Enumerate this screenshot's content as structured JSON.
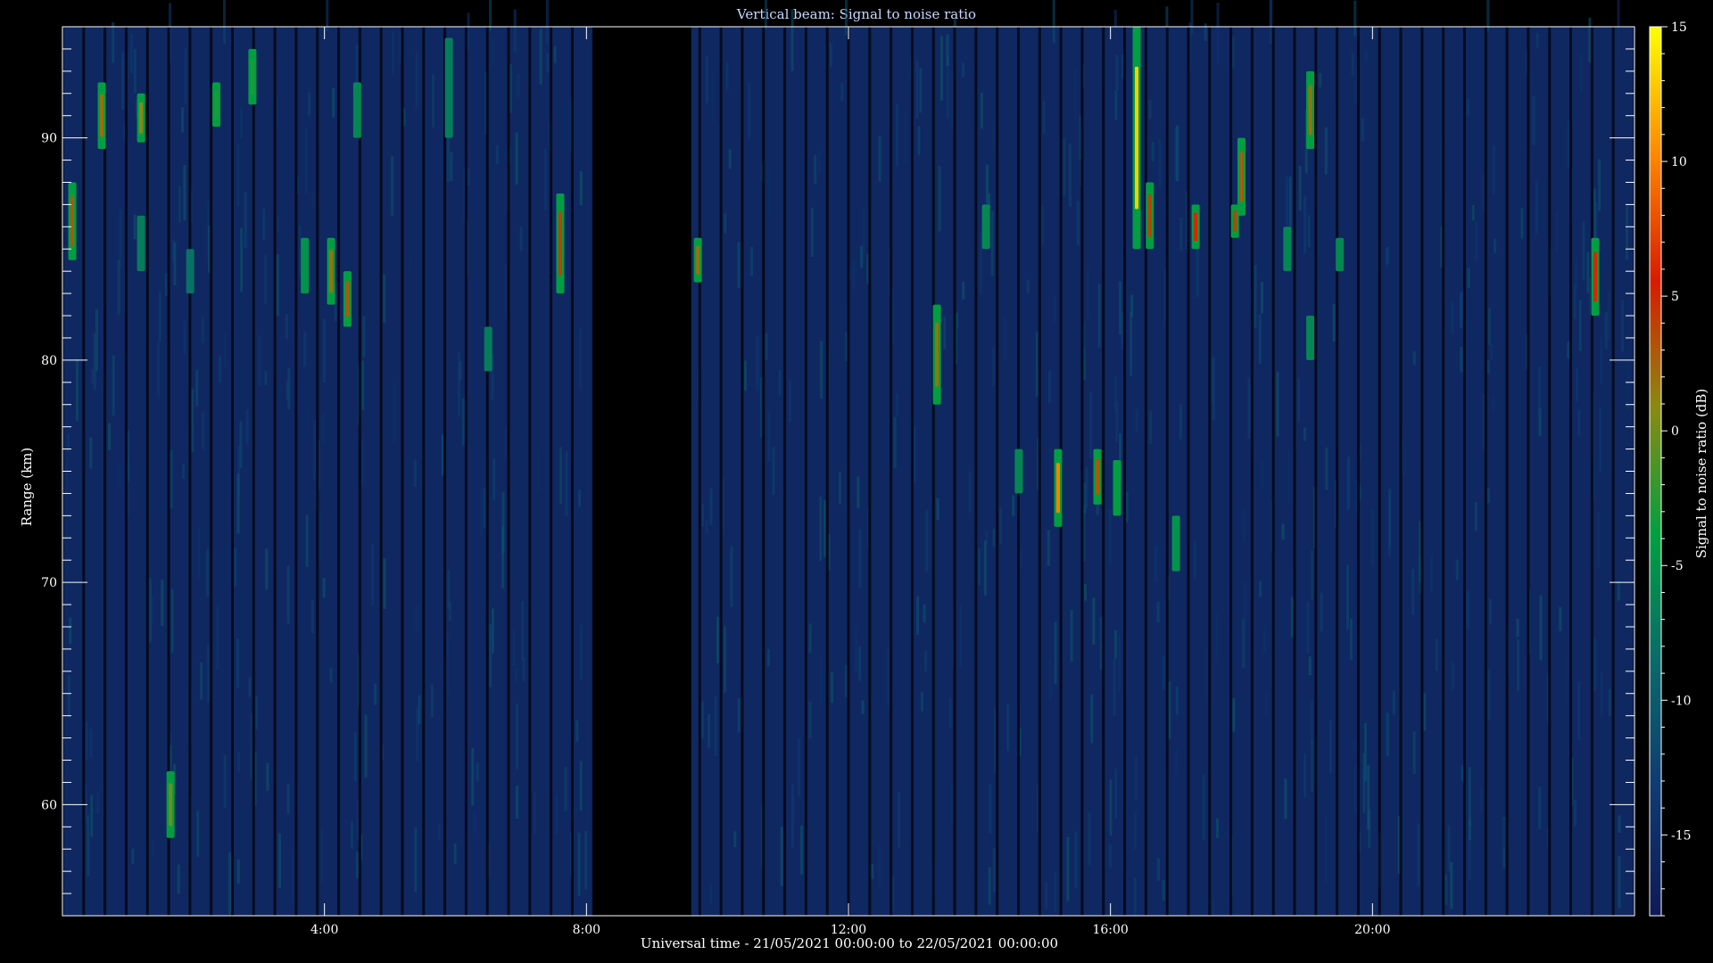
{
  "chart_data": {
    "type": "heatmap",
    "title": "Vertical beam: Signal to noise ratio",
    "xlabel": "Universal time - 21/05/2021 00:00:00 to 22/05/2021 00:00:00",
    "ylabel": "Range (km)",
    "colorbar_label": "Signal to noise ratio (dB)",
    "x_range_hours": [
      0,
      24
    ],
    "x_ticks": [
      {
        "value": 4,
        "label": "4:00"
      },
      {
        "value": 8,
        "label": "8:00"
      },
      {
        "value": 12,
        "label": "12:00"
      },
      {
        "value": 16,
        "label": "16:00"
      },
      {
        "value": 20,
        "label": "20:00"
      }
    ],
    "ylim_km": [
      55,
      95
    ],
    "y_ticks": [
      60,
      70,
      80,
      90
    ],
    "color_range_db": [
      -18,
      15
    ],
    "colorbar_ticks": [
      15,
      10,
      5,
      0,
      -5,
      -10,
      -15
    ],
    "colormap": [
      "#0f1a55",
      "#0f3a72",
      "#0a6a6a",
      "#00a040",
      "#8a8a10",
      "#d81b00",
      "#ff8800",
      "#ffff00"
    ],
    "background_db": -16,
    "data_gap_hours": [
      8.1,
      9.6
    ],
    "notable_echoes": [
      {
        "t": 0.15,
        "r_start": 84.5,
        "r_end": 88,
        "snr": 3
      },
      {
        "t": 0.6,
        "r_start": 89.5,
        "r_end": 92.5,
        "snr": 2
      },
      {
        "t": 1.2,
        "r_start": 89.8,
        "r_end": 92,
        "snr": 1
      },
      {
        "t": 1.2,
        "r_start": 84,
        "r_end": 86.5,
        "snr": -7
      },
      {
        "t": 1.65,
        "r_start": 58.5,
        "r_end": 61.5,
        "snr": 0
      },
      {
        "t": 1.95,
        "r_start": 83,
        "r_end": 85,
        "snr": -8
      },
      {
        "t": 2.35,
        "r_start": 90.5,
        "r_end": 92.5,
        "snr": -3
      },
      {
        "t": 2.9,
        "r_start": 91.5,
        "r_end": 94,
        "snr": -3
      },
      {
        "t": 3.7,
        "r_start": 83,
        "r_end": 85.5,
        "snr": -5
      },
      {
        "t": 4.1,
        "r_start": 82.5,
        "r_end": 85.5,
        "snr": 2
      },
      {
        "t": 4.35,
        "r_start": 81.5,
        "r_end": 84,
        "snr": 3
      },
      {
        "t": 4.5,
        "r_start": 90,
        "r_end": 92.5,
        "snr": -6
      },
      {
        "t": 5.9,
        "r_start": 90,
        "r_end": 94.5,
        "snr": -7
      },
      {
        "t": 6.5,
        "r_start": 79.5,
        "r_end": 81.5,
        "snr": -7
      },
      {
        "t": 7.6,
        "r_start": 83,
        "r_end": 87.5,
        "snr": 4
      },
      {
        "t": 9.7,
        "r_start": 83.5,
        "r_end": 85.5,
        "snr": 2
      },
      {
        "t": 13.35,
        "r_start": 78,
        "r_end": 82.5,
        "snr": 2
      },
      {
        "t": 14.1,
        "r_start": 85,
        "r_end": 87,
        "snr": -6
      },
      {
        "t": 14.6,
        "r_start": 74,
        "r_end": 76,
        "snr": -6
      },
      {
        "t": 15.2,
        "r_start": 72.5,
        "r_end": 76,
        "snr": 10
      },
      {
        "t": 15.8,
        "r_start": 73.5,
        "r_end": 76,
        "snr": 3
      },
      {
        "t": 16.1,
        "r_start": 73,
        "r_end": 75.5,
        "snr": -4
      },
      {
        "t": 16.4,
        "r_start": 85,
        "r_end": 95,
        "snr": 13
      },
      {
        "t": 16.6,
        "r_start": 85,
        "r_end": 88,
        "snr": 4
      },
      {
        "t": 17.0,
        "r_start": 70.5,
        "r_end": 73,
        "snr": -5
      },
      {
        "t": 17.3,
        "r_start": 85,
        "r_end": 87,
        "snr": 6
      },
      {
        "t": 17.9,
        "r_start": 85.5,
        "r_end": 87,
        "snr": 4
      },
      {
        "t": 18.0,
        "r_start": 86.5,
        "r_end": 90,
        "snr": 3
      },
      {
        "t": 18.7,
        "r_start": 84,
        "r_end": 86,
        "snr": -6
      },
      {
        "t": 19.05,
        "r_start": 89.5,
        "r_end": 93,
        "snr": 2
      },
      {
        "t": 19.05,
        "r_start": 80,
        "r_end": 82,
        "snr": -6
      },
      {
        "t": 19.5,
        "r_start": 84,
        "r_end": 85.5,
        "snr": -6
      },
      {
        "t": 23.4,
        "r_start": 82,
        "r_end": 85.5,
        "snr": 6
      }
    ]
  }
}
